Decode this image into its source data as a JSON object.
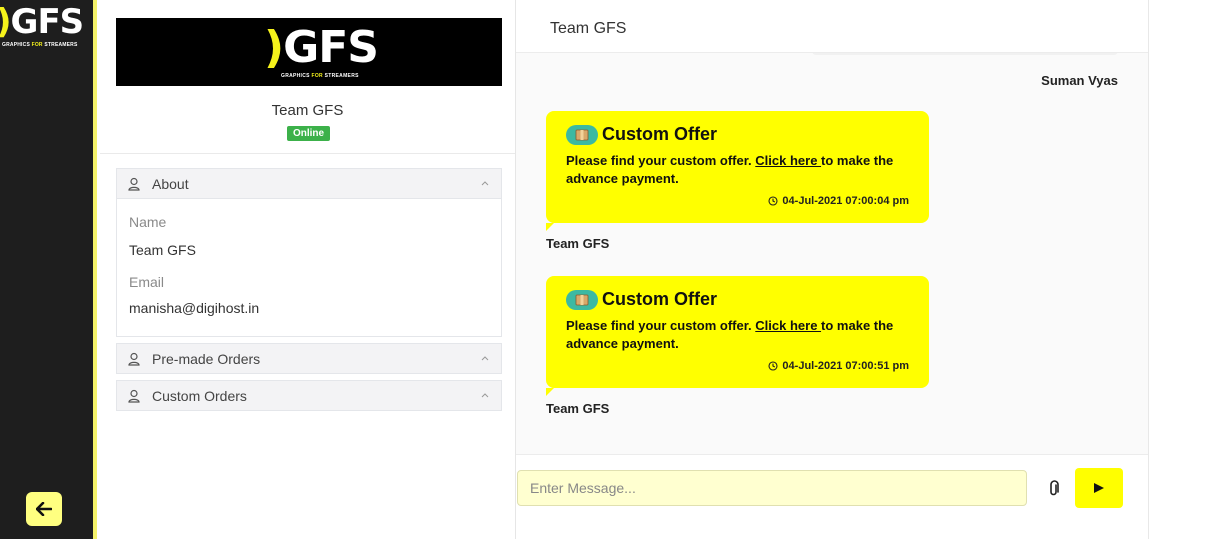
{
  "sidebar": {
    "logo_text": "GFS",
    "logo_tagline_a": "GRAPHICS ",
    "logo_tagline_b": "FOR",
    "logo_tagline_c": " STREAMERS"
  },
  "profile": {
    "banner_logo": "GFS",
    "banner_tagline_a": "GRAPHICS ",
    "banner_tagline_b": "FOR",
    "banner_tagline_c": " STREAMERS",
    "name": "Team GFS",
    "status": "Online",
    "sections": {
      "about": "About",
      "premade": "Pre-made Orders",
      "custom": "Custom Orders"
    },
    "fields": {
      "name_label": "Name",
      "name_value": "Team GFS",
      "email_label": "Email",
      "email_value": "manisha@digihost.in"
    }
  },
  "chat": {
    "title": "Team GFS",
    "prev_sender": "Suman Vyas",
    "messages": [
      {
        "title": "Custom Offer",
        "text_before": "Please find your custom offer. ",
        "link": "Click here ",
        "text_after": "to make the advance payment.",
        "time": "04-Jul-2021 07:00:04 pm",
        "sender": "Team GFS"
      },
      {
        "title": "Custom Offer",
        "text_before": "Please find your custom offer. ",
        "link": "Click here ",
        "text_after": "to make the advance payment.",
        "time": "04-Jul-2021 07:00:51 pm",
        "sender": "Team GFS"
      }
    ],
    "input_placeholder": "Enter Message..."
  },
  "colors": {
    "accent_yellow": "#ffff00",
    "sidebar_dark": "#1e1e1e",
    "online_green": "#3cb14a"
  },
  "icons": {
    "back": "arrow-left-icon",
    "user": "user-icon",
    "chevron": "chevron-up-icon",
    "clock": "clock-icon",
    "attach": "paperclip-icon",
    "send": "send-icon",
    "offer": "package-icon"
  }
}
